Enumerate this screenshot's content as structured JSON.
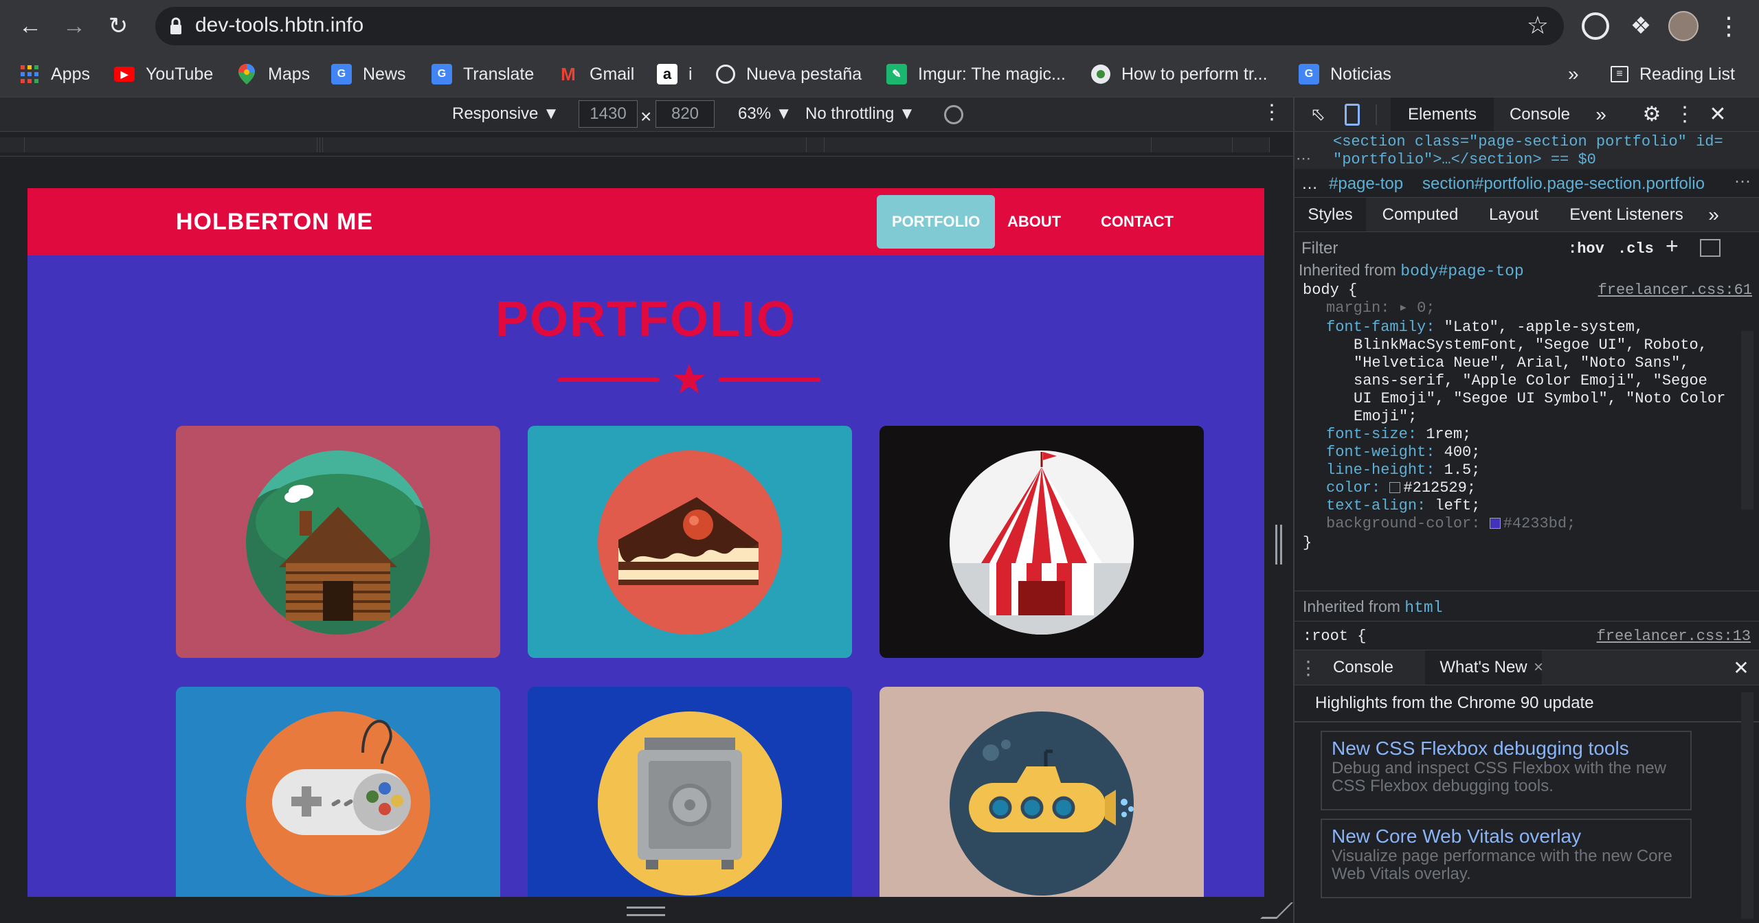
{
  "browser": {
    "url": "dev-tools.hbtn.info",
    "bookmarks": [
      {
        "label": "Apps",
        "icon": "apps-grid-icon"
      },
      {
        "label": "YouTube",
        "icon": "youtube-icon"
      },
      {
        "label": "Maps",
        "icon": "maps-pin-icon"
      },
      {
        "label": "News",
        "icon": "google-news-icon"
      },
      {
        "label": "Translate",
        "icon": "translate-icon"
      },
      {
        "label": "Gmail",
        "icon": "gmail-icon"
      },
      {
        "label": "i",
        "icon": "amazon-icon"
      },
      {
        "label": "Nueva pestaña",
        "icon": "globe-icon"
      },
      {
        "label": "Imgur: The magic...",
        "icon": "imgur-icon"
      },
      {
        "label": "How to perform tr...",
        "icon": "record-icon"
      },
      {
        "label": "Noticias",
        "icon": "google-news-icon"
      }
    ],
    "overflow": "»",
    "reading_list": "Reading List"
  },
  "device_toolbar": {
    "mode": "Responsive ▼",
    "width": "1430",
    "times": "×",
    "height": "820",
    "zoom": "63% ▼",
    "throttle": "No throttling ▼"
  },
  "site": {
    "brand": "HOLBERTON ME",
    "nav": [
      "PORTFOLIO",
      "ABOUT",
      "CONTACT"
    ],
    "section_title": "PORTFOLIO",
    "colors": {
      "nav_bg": "#e10a3e",
      "page_bg": "#4233bd",
      "active_link": "#7fcad3"
    },
    "cards": [
      {
        "name": "cabin",
        "bg": "#b84f65"
      },
      {
        "name": "cake",
        "bg": "#27a2b8"
      },
      {
        "name": "circus",
        "bg": "#131011"
      },
      {
        "name": "game-controller",
        "bg": "#2584c4"
      },
      {
        "name": "safe",
        "bg": "#133db5"
      },
      {
        "name": "submarine",
        "bg": "#cfb3a6"
      }
    ]
  },
  "devtools": {
    "main_tabs": [
      "Elements",
      "Console"
    ],
    "more": "»",
    "dom_line1": "<section class=\"page-section portfolio\" id=",
    "dom_line2": "\"portfolio\">…</section> == $0",
    "breadcrumb_1": "…",
    "breadcrumb_2": "#page-top",
    "breadcrumb_3": "section#portfolio.page-section.portfolio",
    "style_tabs": [
      "Styles",
      "Computed",
      "Layout",
      "Event Listeners"
    ],
    "filter_placeholder": "Filter",
    "hov": ":hov",
    "cls": ".cls",
    "inherited_from_body": "Inherited from",
    "inherited_body_selector": "body#page-top",
    "rule_selector": "body {",
    "rule_source": "freelancer.css:61",
    "props": {
      "margin": "margin: ▸ 0;",
      "font_family": "font-family:",
      "font_family_val_1": "\"Lato\", -apple-system,",
      "font_family_val_2": "BlinkMacSystemFont, \"Segoe UI\", Roboto,",
      "font_family_val_3": "\"Helvetica Neue\", Arial, \"Noto Sans\",",
      "font_family_val_4": "sans-serif, \"Apple Color Emoji\", \"Segoe",
      "font_family_val_5": "UI Emoji\", \"Segoe UI Symbol\", \"Noto Color",
      "font_family_val_6": "Emoji\";",
      "font_size": "font-size:",
      "font_size_val": "1rem;",
      "font_weight": "font-weight:",
      "font_weight_val": "400;",
      "line_height": "line-height:",
      "line_height_val": "1.5;",
      "color": "color:",
      "color_val": "#212529;",
      "text_align": "text-align:",
      "text_align_val": "left;",
      "background_color": "background-color:",
      "background_color_val": "#4233bd;"
    },
    "rule_close": "}",
    "inherited_from_html": "Inherited from",
    "inherited_html_selector": "html",
    "root_selector": ":root {",
    "root_source": "freelancer.css:13",
    "drawer_tabs": [
      "Console",
      "What's New"
    ],
    "drawer_close": "×",
    "whats_new_heading": "Highlights from the Chrome 90 update",
    "whats_new_items": [
      {
        "title": "New CSS Flexbox debugging tools",
        "desc": "Debug and inspect CSS Flexbox with the new CSS Flexbox debugging tools."
      },
      {
        "title": "New Core Web Vitals overlay",
        "desc": "Visualize page performance with the new Core Web Vitals overlay."
      }
    ]
  }
}
